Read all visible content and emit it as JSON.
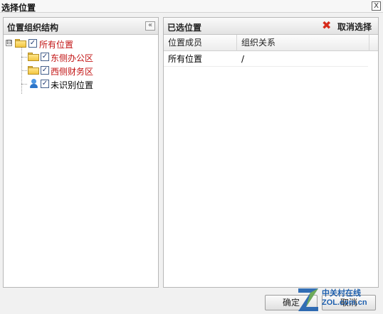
{
  "window": {
    "title": "选择位置",
    "close_glyph": "X"
  },
  "left_panel": {
    "title": "位置组织结构",
    "collapse_glyph": "«",
    "tree": [
      {
        "label": "所有位置",
        "icon": "folder-icon",
        "checked": true,
        "expanded": true,
        "toggle_glyph": "⊟",
        "color": "#c21313",
        "level": 0
      },
      {
        "label": "东侧办公区",
        "icon": "folder-icon",
        "checked": true,
        "color": "#c21313",
        "level": 1
      },
      {
        "label": "西侧财务区",
        "icon": "folder-icon",
        "checked": true,
        "color": "#c21313",
        "level": 1
      },
      {
        "label": "未识别位置",
        "icon": "user-icon",
        "checked": true,
        "color": "#000000",
        "level": 1
      }
    ],
    "check_glyph": "✓"
  },
  "right_panel": {
    "title": "已选位置",
    "cancel_selection": "取消选择",
    "cancel_icon_glyph": "✖",
    "columns": [
      "位置成员",
      "组织关系"
    ],
    "rows": [
      {
        "member": "所有位置",
        "relation": "/"
      }
    ]
  },
  "footer": {
    "ok": "确定",
    "cancel": "取消"
  },
  "watermark": {
    "line1": "中关村在线",
    "line2": "ZOL.com.cn"
  },
  "colors": {
    "tree_highlight": "#c21313",
    "cancel_icon": "#d62b1b",
    "watermark": "#1d5fae"
  }
}
